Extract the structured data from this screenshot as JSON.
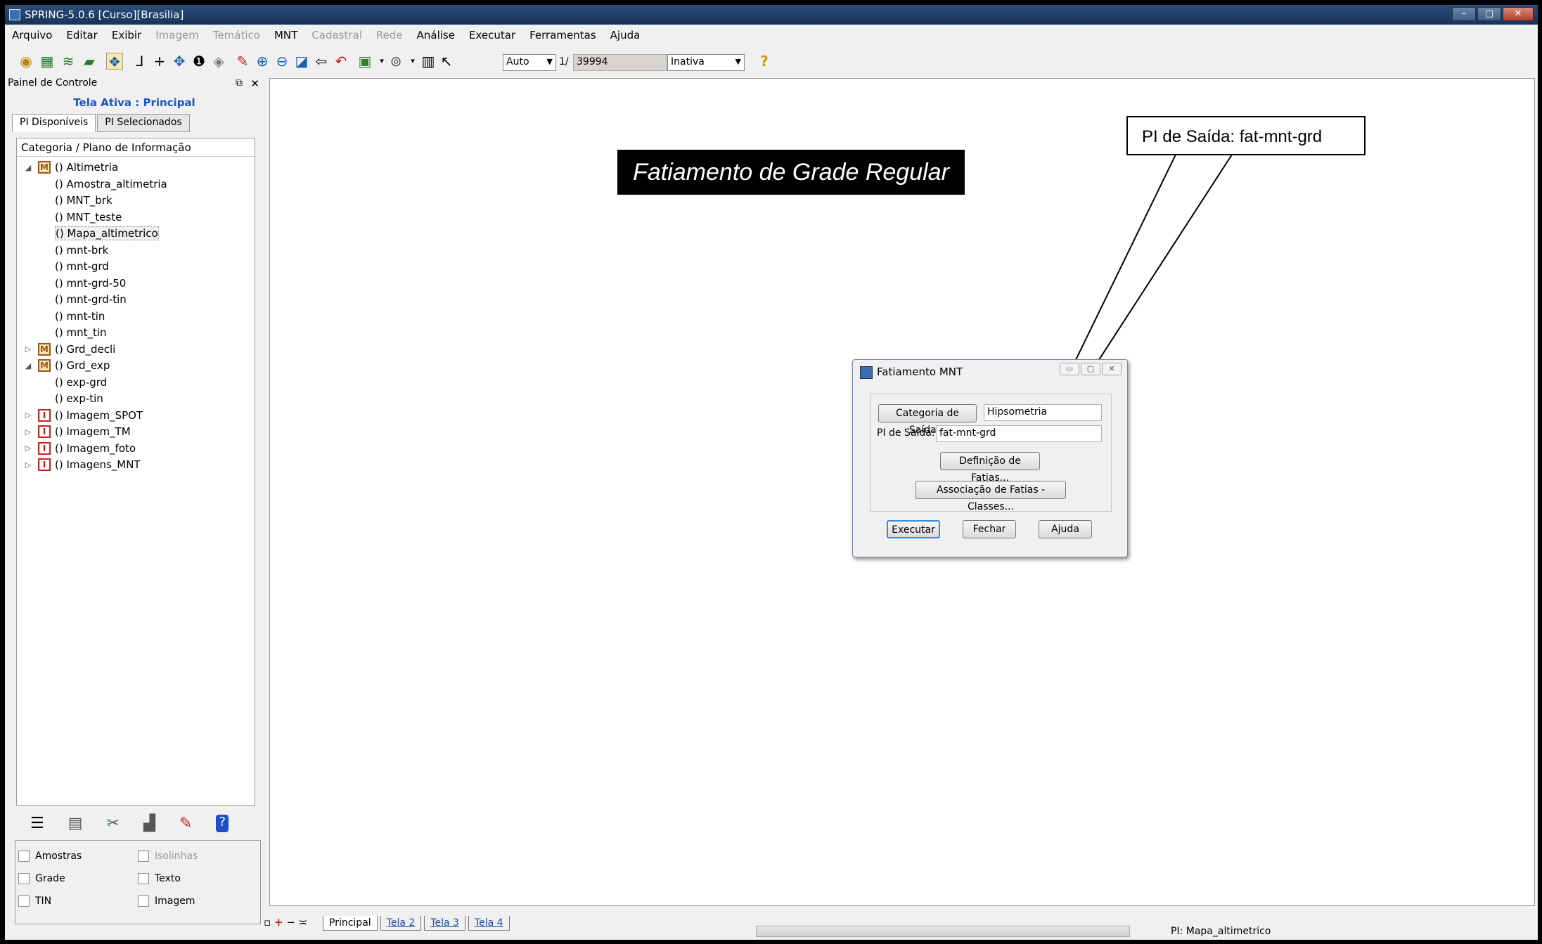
{
  "window": {
    "title": "SPRING-5.0.6 [Curso][Brasilia]"
  },
  "menu": [
    "Arquivo",
    "Editar",
    "Exibir",
    "Imagem",
    "Temático",
    "MNT",
    "Cadastral",
    "Rede",
    "Análise",
    "Executar",
    "Ferramentas",
    "Ajuda"
  ],
  "menu_disabled": [
    "Imagem",
    "Temático",
    "Cadastral",
    "Rede"
  ],
  "toolbar": {
    "zoom_mode": "Auto",
    "scale_prefix": "1/",
    "scale_value": "39994",
    "state": "Inativa"
  },
  "panel": {
    "title": "Painel de Controle",
    "active_screen": "Tela Ativa : Principal",
    "tabs": [
      "PI Disponíveis",
      "PI Selecionados"
    ],
    "tree_header": "Categoria / Plano de Informação",
    "tree": [
      {
        "label": "() Altimetria",
        "badge": "M",
        "level": 0,
        "expander": "▲"
      },
      {
        "label": "() Amostra_altimetria",
        "level": 1
      },
      {
        "label": "() MNT_brk",
        "level": 1
      },
      {
        "label": "() MNT_teste",
        "level": 1
      },
      {
        "label": "() Mapa_altimetrico",
        "level": 1
      },
      {
        "label": "() mnt-brk",
        "level": 1
      },
      {
        "label": "() mnt-grd",
        "level": 1
      },
      {
        "label": "() mnt-grd-50",
        "level": 1
      },
      {
        "label": "() mnt-grd-tin",
        "level": 1
      },
      {
        "label": "() mnt-tin",
        "level": 1
      },
      {
        "label": "() mnt_tin",
        "level": 1
      },
      {
        "label": "() Grd_decli",
        "badge": "M",
        "level": 0,
        "expander": "▷"
      },
      {
        "label": "() Grd_exp",
        "badge": "M",
        "level": 0,
        "expander": "▲"
      },
      {
        "label": "() exp-grd",
        "level": 1
      },
      {
        "label": "() exp-tin",
        "level": 1
      },
      {
        "label": "() Imagem_SPOT",
        "badge": "I",
        "level": 0,
        "expander": "▷"
      },
      {
        "label": "() Imagem_TM",
        "badge": "I",
        "level": 0,
        "expander": "▷"
      },
      {
        "label": "() Imagem_foto",
        "badge": "I",
        "level": 0,
        "expander": "▷"
      },
      {
        "label": "() Imagens_MNT",
        "badge": "I",
        "level": 0,
        "expander": "▷"
      }
    ],
    "selected_item": "() Mapa_altimetrico",
    "checks": [
      {
        "label": "Amostras",
        "enabled": true
      },
      {
        "label": "Isolinhas",
        "enabled": false
      },
      {
        "label": "Grade",
        "enabled": true
      },
      {
        "label": "Texto",
        "enabled": true
      },
      {
        "label": "TIN",
        "enabled": true
      },
      {
        "label": "Imagem",
        "enabled": true
      }
    ]
  },
  "annotation": {
    "title": "Fatiamento de Grade Regular",
    "callout": "PI de Saída: fat-mnt-grd"
  },
  "dialog": {
    "title": "Fatiamento MNT",
    "category_button": "Categoria de Saída...",
    "category_value": "Hipsometria",
    "pi_label": "PI de Saída:",
    "pi_value": "fat-mnt-grd",
    "slices_button": "Definição de Fatias...",
    "assoc_button": "Associação de Fatias - Classes...",
    "execute": "Executar",
    "close": "Fechar",
    "help": "Ajuda"
  },
  "status": {
    "tabs": [
      "Principal",
      "Tela 2",
      "Tela 3",
      "Tela 4"
    ],
    "active_tab": "Principal",
    "pi": "PI: Mapa_altimetrico"
  }
}
